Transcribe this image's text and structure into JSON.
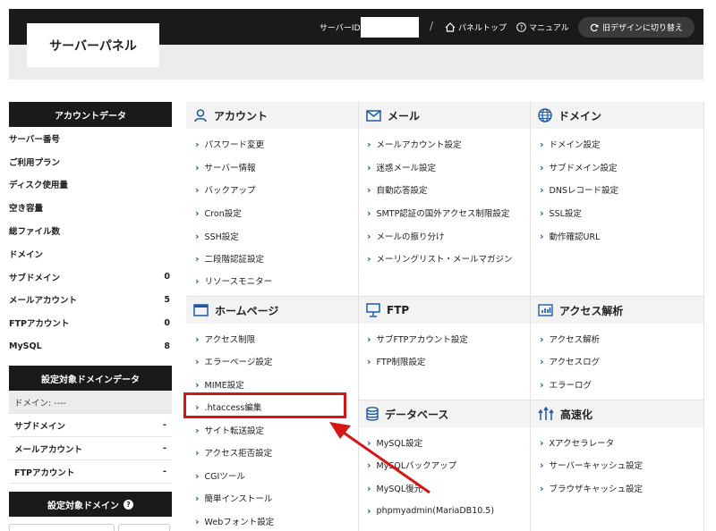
{
  "header": {
    "logo": "サーバーパネル",
    "server_id_label": "サーバーID",
    "panel_top": "パネルトップ",
    "manual": "マニュアル",
    "old_design": "旧デザインに切り替え"
  },
  "sidebar": {
    "account_heading": "アカウントデータ",
    "account_rows": [
      {
        "label": "サーバー番号",
        "value": ""
      },
      {
        "label": "ご利用プラン",
        "value": ""
      },
      {
        "label": "ディスク使用量",
        "value": ""
      },
      {
        "label": "空き容量",
        "value": ""
      },
      {
        "label": "総ファイル数",
        "value": ""
      },
      {
        "label": "ドメイン",
        "value": ""
      },
      {
        "label": "サブドメイン",
        "value": "0"
      },
      {
        "label": "メールアカウント",
        "value": "5"
      },
      {
        "label": "FTPアカウント",
        "value": "0"
      },
      {
        "label": "MySQL",
        "value": "8"
      }
    ],
    "domain_heading": "設定対象ドメインデータ",
    "domain_rows": [
      {
        "label": "ドメイン: ----",
        "value": ""
      },
      {
        "label": "サブドメイン",
        "value": "-"
      },
      {
        "label": "メールアカウント",
        "value": "-"
      },
      {
        "label": "FTPアカウント",
        "value": "-"
      }
    ],
    "target_domain_heading": "設定対象ドメイン",
    "help_icon": "?"
  },
  "sections": {
    "account": {
      "title": "アカウント",
      "links": [
        "パスワード変更",
        "サーバー情報",
        "バックアップ",
        "Cron設定",
        "SSH設定",
        "二段階認証設定",
        "リソースモニター"
      ]
    },
    "mail": {
      "title": "メール",
      "links": [
        "メールアカウント設定",
        "迷惑メール設定",
        "自動応答設定",
        "SMTP認証の国外アクセス制限設定",
        "メールの振り分け",
        "メーリングリスト・メールマガジン"
      ]
    },
    "domain": {
      "title": "ドメイン",
      "links": [
        "ドメイン設定",
        "サブドメイン設定",
        "DNSレコード設定",
        "SSL設定",
        "動作確認URL"
      ]
    },
    "homepage": {
      "title": "ホームページ",
      "links": [
        "アクセス制限",
        "エラーページ設定",
        "MIME設定",
        ".htaccess編集",
        "サイト転送設定",
        "アクセス拒否設定",
        "CGIツール",
        "簡単インストール",
        "Webフォント設定"
      ]
    },
    "ftp": {
      "title": "FTP",
      "links": [
        "サブFTPアカウント設定",
        "FTP制限設定"
      ]
    },
    "access": {
      "title": "アクセス解析",
      "links": [
        "アクセス解析",
        "アクセスログ",
        "エラーログ"
      ]
    },
    "database": {
      "title": "データベース",
      "links": [
        "MySQL設定",
        "MySQLバックアップ",
        "MySQL復元",
        "phpmyadmin(MariaDB10.5)"
      ]
    },
    "speed": {
      "title": "高速化",
      "links": [
        "Xアクセラレータ",
        "サーバーキャッシュ設定",
        "ブラウザキャッシュ設定"
      ]
    }
  },
  "colors": {
    "accent": "#1e5aa8",
    "highlight": "#d61515",
    "dark": "#1a1a1a"
  }
}
